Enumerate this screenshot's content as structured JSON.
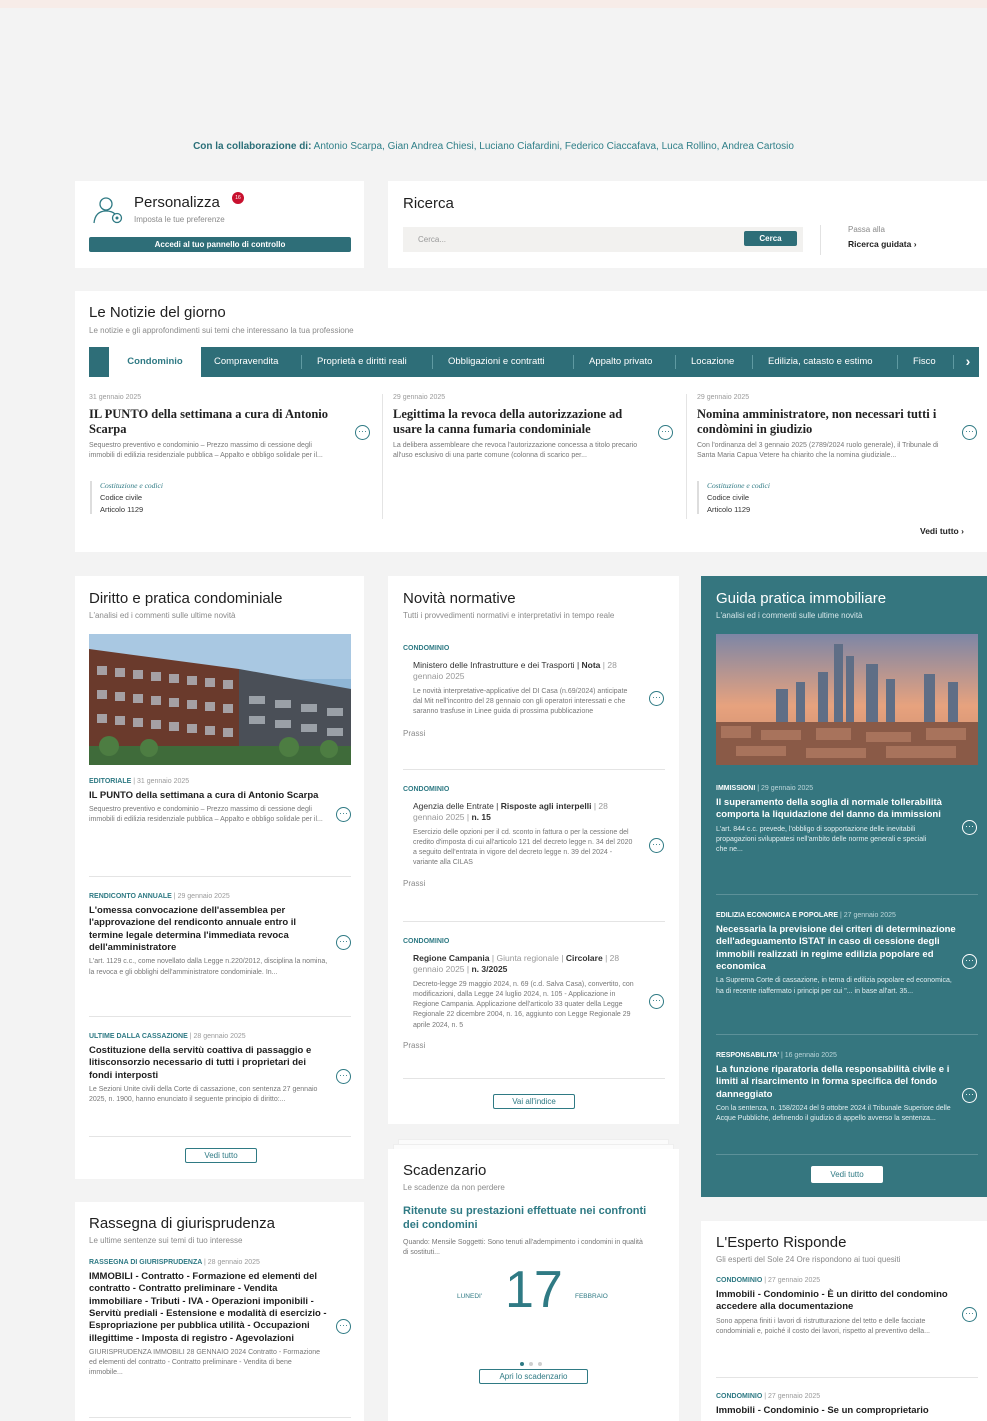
{
  "collab": {
    "label": "Con la collaborazione di:",
    "names": " Antonio Scarpa, Gian Andrea Chiesi, Luciano Ciafardini, Federico Ciaccafava, Luca Rollino, Andrea Cartosio"
  },
  "personalizza": {
    "title": "Personalizza",
    "badge": "16",
    "subtitle": "Imposta le tue preferenze",
    "button": "Accedi al tuo pannello di controllo"
  },
  "ricerca": {
    "title": "Ricerca",
    "placeholder": "Cerca...",
    "button": "Cerca",
    "guided_pre": "Passa alla",
    "guided": "Ricerca guidata"
  },
  "notizie": {
    "title": "Le Notizie del giorno",
    "subtitle": "Le notizie e gli approfondimenti sui temi che interessano la tua professione",
    "tabs": [
      "Condominio",
      "Compravendita",
      "Proprietà e diritti reali",
      "Obbligazioni e contratti",
      "Appalto privato",
      "Locazione",
      "Edilizia, catasto e estimo",
      "Fisco"
    ],
    "articles": [
      {
        "date": "31 gennaio 2025",
        "title": "IL PUNTO della settimana a cura di Antonio Scarpa",
        "excerpt": "Sequestro preventivo e condominio – Prezzo massimo di cessione degli immobili di edilizia residenziale pubblica – Appalto e obbligo solidale per il...",
        "tag_label": "Costituzione e codici",
        "tag_1": "Codice civile",
        "tag_2": "Articolo 1129"
      },
      {
        "date": "29 gennaio 2025",
        "title": "Legittima la revoca della autorizzazione ad usare la canna fumaria condominiale",
        "excerpt": "La delibera assembleare che revoca l'autorizzazione concessa a titolo precario all'uso esclusivo di una parte comune (colonna di scarico per..."
      },
      {
        "date": "29 gennaio 2025",
        "title": "Nomina amministratore, non necessari tutti i condòmini in giudizio",
        "excerpt": "Con l'ordinanza del 3 gennaio 2025 (2789/2024 ruolo generale), il Tribunale di Santa Maria Capua Vetere ha chiarito che la nomina giudiziale...",
        "tag_label": "Costituzione e codici",
        "tag_1": "Codice civile",
        "tag_2": "Articolo 1129"
      }
    ],
    "vedi_tutto": "Vedi tutto"
  },
  "diritto": {
    "title": "Diritto e pratica condominiale",
    "subtitle": "L'analisi ed i commenti sulle ultime novità",
    "items": [
      {
        "cat": "EDITORIALE",
        "date": "31 gennaio 2025",
        "title": "IL PUNTO della settimana a cura di Antonio Scarpa",
        "excerpt": "Sequestro preventivo e condominio – Prezzo massimo di cessione degli immobili di edilizia residenziale pubblica – Appalto e obbligo solidale per il..."
      },
      {
        "cat": "RENDICONTO ANNUALE",
        "date": "29 gennaio 2025",
        "title": "L'omessa convocazione dell'assemblea per l'approvazione del rendiconto annuale entro il termine legale determina l'immediata revoca dell'amministratore",
        "excerpt": "L'art. 1129 c.c., come novellato dalla Legge n.220/2012, disciplina la nomina, la revoca e gli obblighi dell'amministratore condominiale. In..."
      },
      {
        "cat": "ULTIME DALLA CASSAZIONE",
        "date": "28 gennaio 2025",
        "title": "Costituzione della servitù coattiva di passaggio e litisconsorzio necessario di tutti i proprietari dei fondi interposti",
        "excerpt": "Le Sezioni Unite civili della Corte di cassazione, con sentenza 27 gennaio 2025, n. 1900, hanno enunciato il seguente principio di diritto:..."
      }
    ],
    "button": "Vedi tutto"
  },
  "novita": {
    "title": "Novità normative",
    "subtitle": "Tutti i provvedimenti normativi e interpretativi in tempo reale",
    "items": [
      {
        "cat": "CONDOMINIO",
        "src": "Ministero delle Infrastrutture e dei Trasporti",
        "kind": "Nota",
        "date": "28 gennaio 2025",
        "num": "",
        "excerpt": "Le novità interpretative-applicative del DI Casa (n.69/2024) anticipate dal Mit nell'incontro del 28 gennaio con gli operatori interessati e che saranno trasfuse in Linee guida di prossima pubblicazione",
        "label": "Prassi"
      },
      {
        "cat": "CONDOMINIO",
        "src": "Agenzia delle Entrate",
        "kind": "Risposte agli interpelli",
        "date": "28 gennaio 2025",
        "num": "n. 15",
        "excerpt": "Esercizio delle opzioni per il cd. sconto in fattura o per la cessione del credito d'imposta di cui all'articolo 121 del decreto legge n. 34 del 2020 a seguito dell'entrata in vigore del decreto legge n. 39 del 2024 - variante alla CILAS",
        "label": "Prassi"
      },
      {
        "cat": "CONDOMINIO",
        "src": "Regione Campania",
        "kind": "Circolare",
        "src2": "Giunta regionale",
        "date": "28 gennaio 2025",
        "num": "n. 3/2025",
        "excerpt": "Decreto-legge 29 maggio 2024, n. 69 (c.d. Salva Casa), convertito, con modificazioni, dalla Legge 24 luglio 2024, n. 105 - Applicazione in Regione Campania. Applicazione dell'articolo 33 quater della Legge Regionale 22 dicembre 2004, n. 16, aggiunto con Legge Regionale 29 aprile 2024, n. 5",
        "label": "Prassi"
      }
    ],
    "button": "Vai all'indice"
  },
  "guida": {
    "title": "Guida pratica immobiliare",
    "subtitle": "L'analisi ed i commenti sulle ultime novità",
    "items": [
      {
        "cat": "IMMISSIONI",
        "date": "29 gennaio 2025",
        "title": "Il superamento della soglia di normale tollerabilità comporta la liquidazione del danno da immissioni",
        "excerpt": "L'art. 844 c.c. prevede, l'obbligo di sopportazione delle inevitabili propagazioni sviluppatesi nell'ambito delle norme generali e speciali che ne..."
      },
      {
        "cat": "EDILIZIA ECONOMICA E POPOLARE",
        "date": "27 gennaio 2025",
        "title": "Necessaria la previsione dei criteri di determinazione dell'adeguamento ISTAT in caso di cessione degli immobili realizzati in regime edilizia popolare ed economica",
        "excerpt": "La Suprema Corte di cassazione, in tema di edilizia popolare ed economica, ha di recente riaffermato i principi per cui \"... in base all'art. 35..."
      },
      {
        "cat": "RESPONSABILITA'",
        "date": "16 gennaio 2025",
        "title": "La funzione riparatoria della responsabilità civile e i limiti al risarcimento in forma specifica del fondo danneggiato",
        "excerpt": "Con la sentenza, n. 158/2024 del 9 ottobre 2024 il Tribunale Superiore delle Acque Pubbliche, definendo il giudizio di appello avverso la sentenza..."
      }
    ],
    "button": "Vedi tutto"
  },
  "scadenzario": {
    "title": "Scadenzario",
    "subtitle": "Le scadenze da non perdere",
    "item_title": "Ritenute su prestazioni effettuate nei confronti dei condomini",
    "item_text": "Quando: Mensile Soggetti: Sono tenuti all'adempimento i condomini in qualità di sostituti...",
    "weekday": "LUNEDI'",
    "day": "17",
    "month": "FEBBRAIO",
    "button": "Apri lo scadenzario"
  },
  "rassegna": {
    "title": "Rassegna di giurisprudenza",
    "subtitle": "Le ultime sentenze sui temi di tuo interesse",
    "cat": "RASSEGNA DI GIURISPRUDENZA",
    "date": "28 gennaio 2025",
    "item_title": "IMMOBILI - Contratto - Formazione ed elementi del contratto - Contratto preliminare - Vendita immobiliare - Tributi - IVA - Operazioni imponibili - Servitù prediali - Estensione e modalità di esercizio - Espropriazione per pubblica utilità - Occupazioni illegittime - Imposta di registro - Agevolazioni",
    "excerpt": "GIURISPRUDENZA IMMOBILI 28 GENNAIO 2024 Contratto - Formazione ed elementi del contratto - Contratto preliminare - Vendita di bene immobile..."
  },
  "esperto": {
    "title": "L'Esperto Risponde",
    "subtitle": "Gli esperti del Sole 24 Ore rispondono ai tuoi quesiti",
    "items": [
      {
        "cat": "CONDOMINIO",
        "date": "27 gennaio 2025",
        "title": "Immobili - Condominio - È un diritto del condomino accedere alla documentazione",
        "excerpt": "Sono appena finiti i lavori di ristrutturazione del tetto e delle facciate condominiali e, poiché il costo dei lavori, rispetto al preventivo della..."
      },
      {
        "cat": "CONDOMINIO",
        "date": "27 gennaio 2025",
        "title": "Immobili - Condominio - Se un comproprietario",
        "excerpt": ""
      }
    ]
  },
  "colors": {
    "teal": "#2e6e78",
    "teal_panel": "#35767f",
    "accent_text": "#2f7a84",
    "badge": "#c8102e"
  }
}
